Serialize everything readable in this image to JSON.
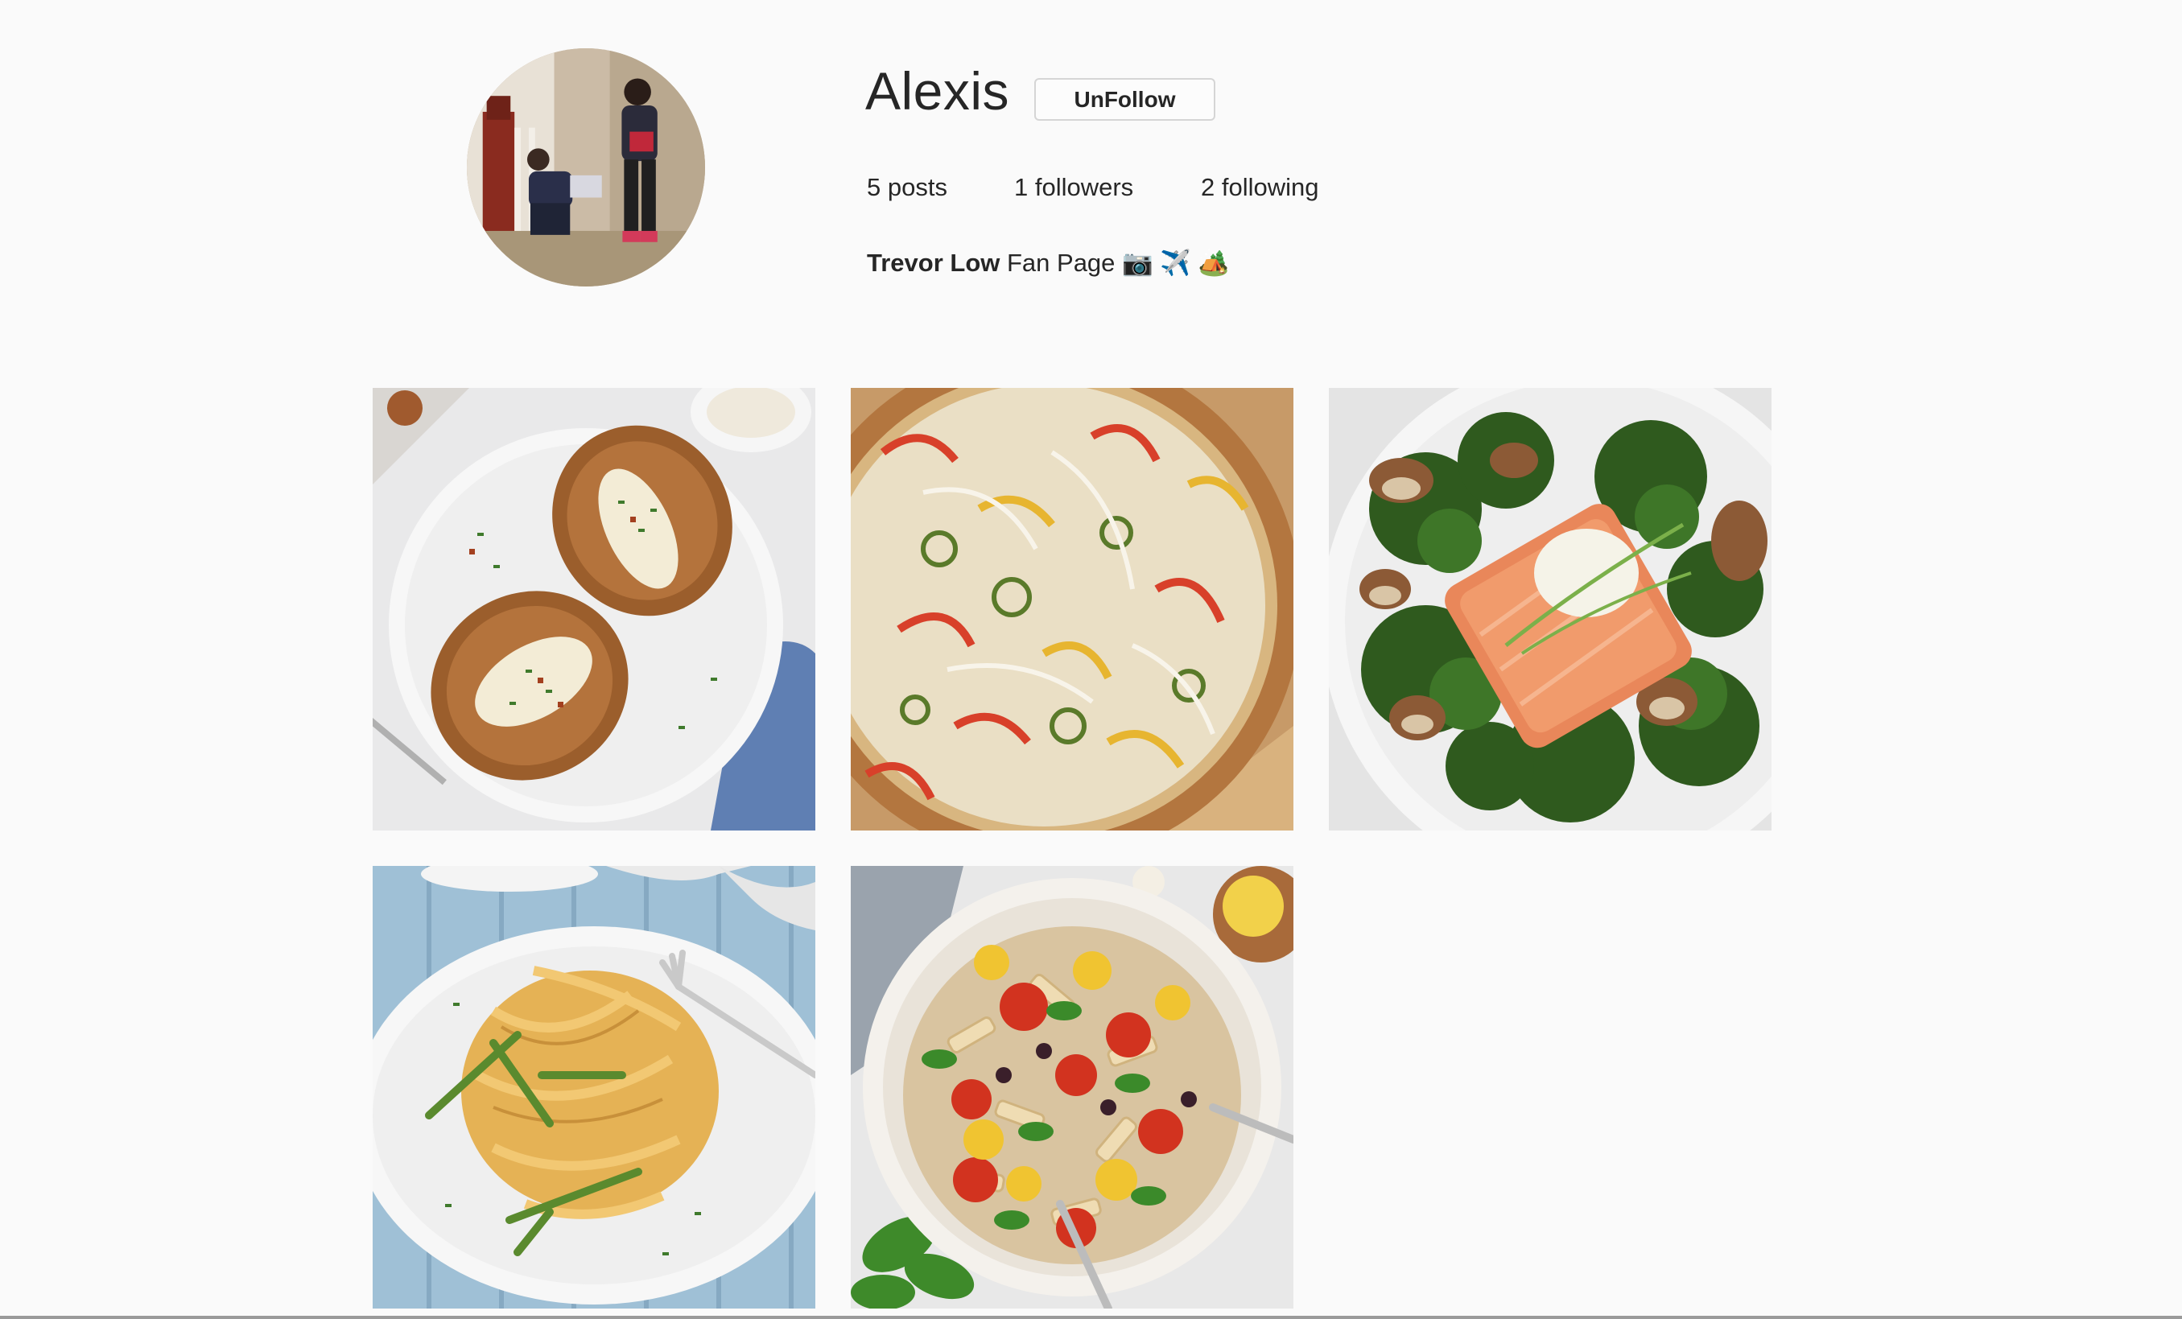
{
  "profile": {
    "username": "Alexis",
    "follow_button_label": "UnFollow",
    "stats": {
      "posts": "5 posts",
      "followers": "1 followers",
      "following": "2 following"
    },
    "bio": {
      "name": "Trevor Low",
      "text": " Fan Page 📷 ✈️ 🏕️"
    },
    "avatar_icon": "profile-photo"
  },
  "posts": [
    {
      "subject": "baked-potatoes-photo"
    },
    {
      "subject": "pepper-pizza-photo"
    },
    {
      "subject": "salmon-kale-mushrooms-photo"
    },
    {
      "subject": "asparagus-pasta-photo"
    },
    {
      "subject": "penne-vegetable-salad-photo"
    }
  ]
}
